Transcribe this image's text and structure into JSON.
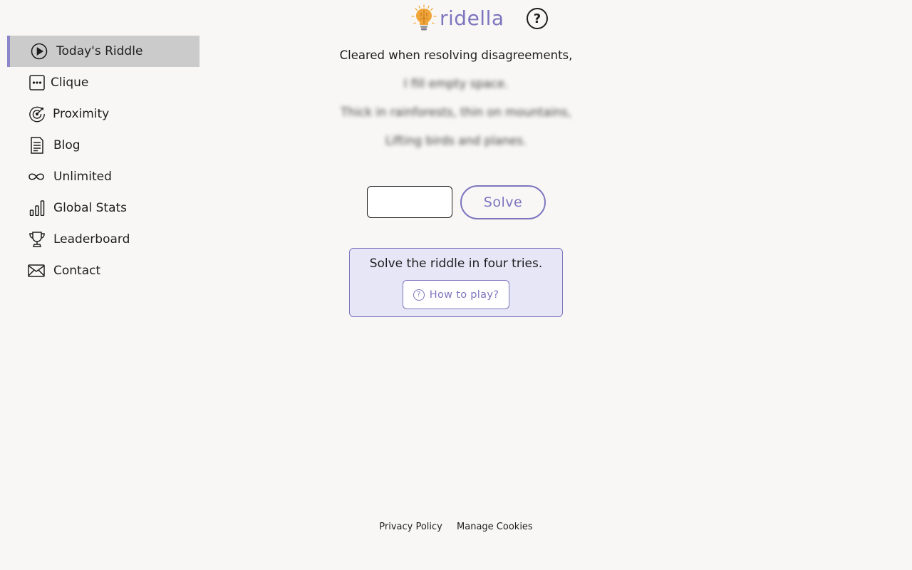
{
  "header": {
    "logo_text": "ridella",
    "logo_icon": "lightbulb-brain-icon",
    "help_icon": "question-circle-icon",
    "help_glyph": "?"
  },
  "sidebar": {
    "items": [
      {
        "label": "Today's Riddle",
        "icon": "play-circle-icon",
        "active": true
      },
      {
        "label": "Clique",
        "icon": "dots-square-icon",
        "active": false
      },
      {
        "label": "Proximity",
        "icon": "target-icon",
        "active": false
      },
      {
        "label": "Blog",
        "icon": "document-icon",
        "active": false
      },
      {
        "label": "Unlimited",
        "icon": "infinity-icon",
        "active": false
      },
      {
        "label": "Global Stats",
        "icon": "bar-chart-icon",
        "active": false
      },
      {
        "label": "Leaderboard",
        "icon": "trophy-icon",
        "active": false
      },
      {
        "label": "Contact",
        "icon": "envelope-icon",
        "active": false
      }
    ]
  },
  "riddle": {
    "lines": [
      {
        "text": "Cleared when resolving disagreements,",
        "blurred": false
      },
      {
        "text": "I fill empty space.",
        "blurred": true
      },
      {
        "text": "Thick in rainforests, thin on mountains,",
        "blurred": true
      },
      {
        "text": "Lifting birds and planes.",
        "blurred": true
      }
    ]
  },
  "answer": {
    "value": "",
    "placeholder": "",
    "solve_label": "Solve"
  },
  "info": {
    "text": "Solve the riddle in four tries.",
    "how_to_play_label": "How to play?",
    "how_to_play_icon": "question-circle-icon",
    "how_to_play_glyph": "?"
  },
  "footer": {
    "privacy_label": "Privacy Policy",
    "cookies_label": "Manage Cookies"
  },
  "colors": {
    "accent": "#7d76be",
    "active_bg": "#cbcbcb",
    "info_bg": "#e7e6f7",
    "page_bg": "#f8f7f6"
  }
}
